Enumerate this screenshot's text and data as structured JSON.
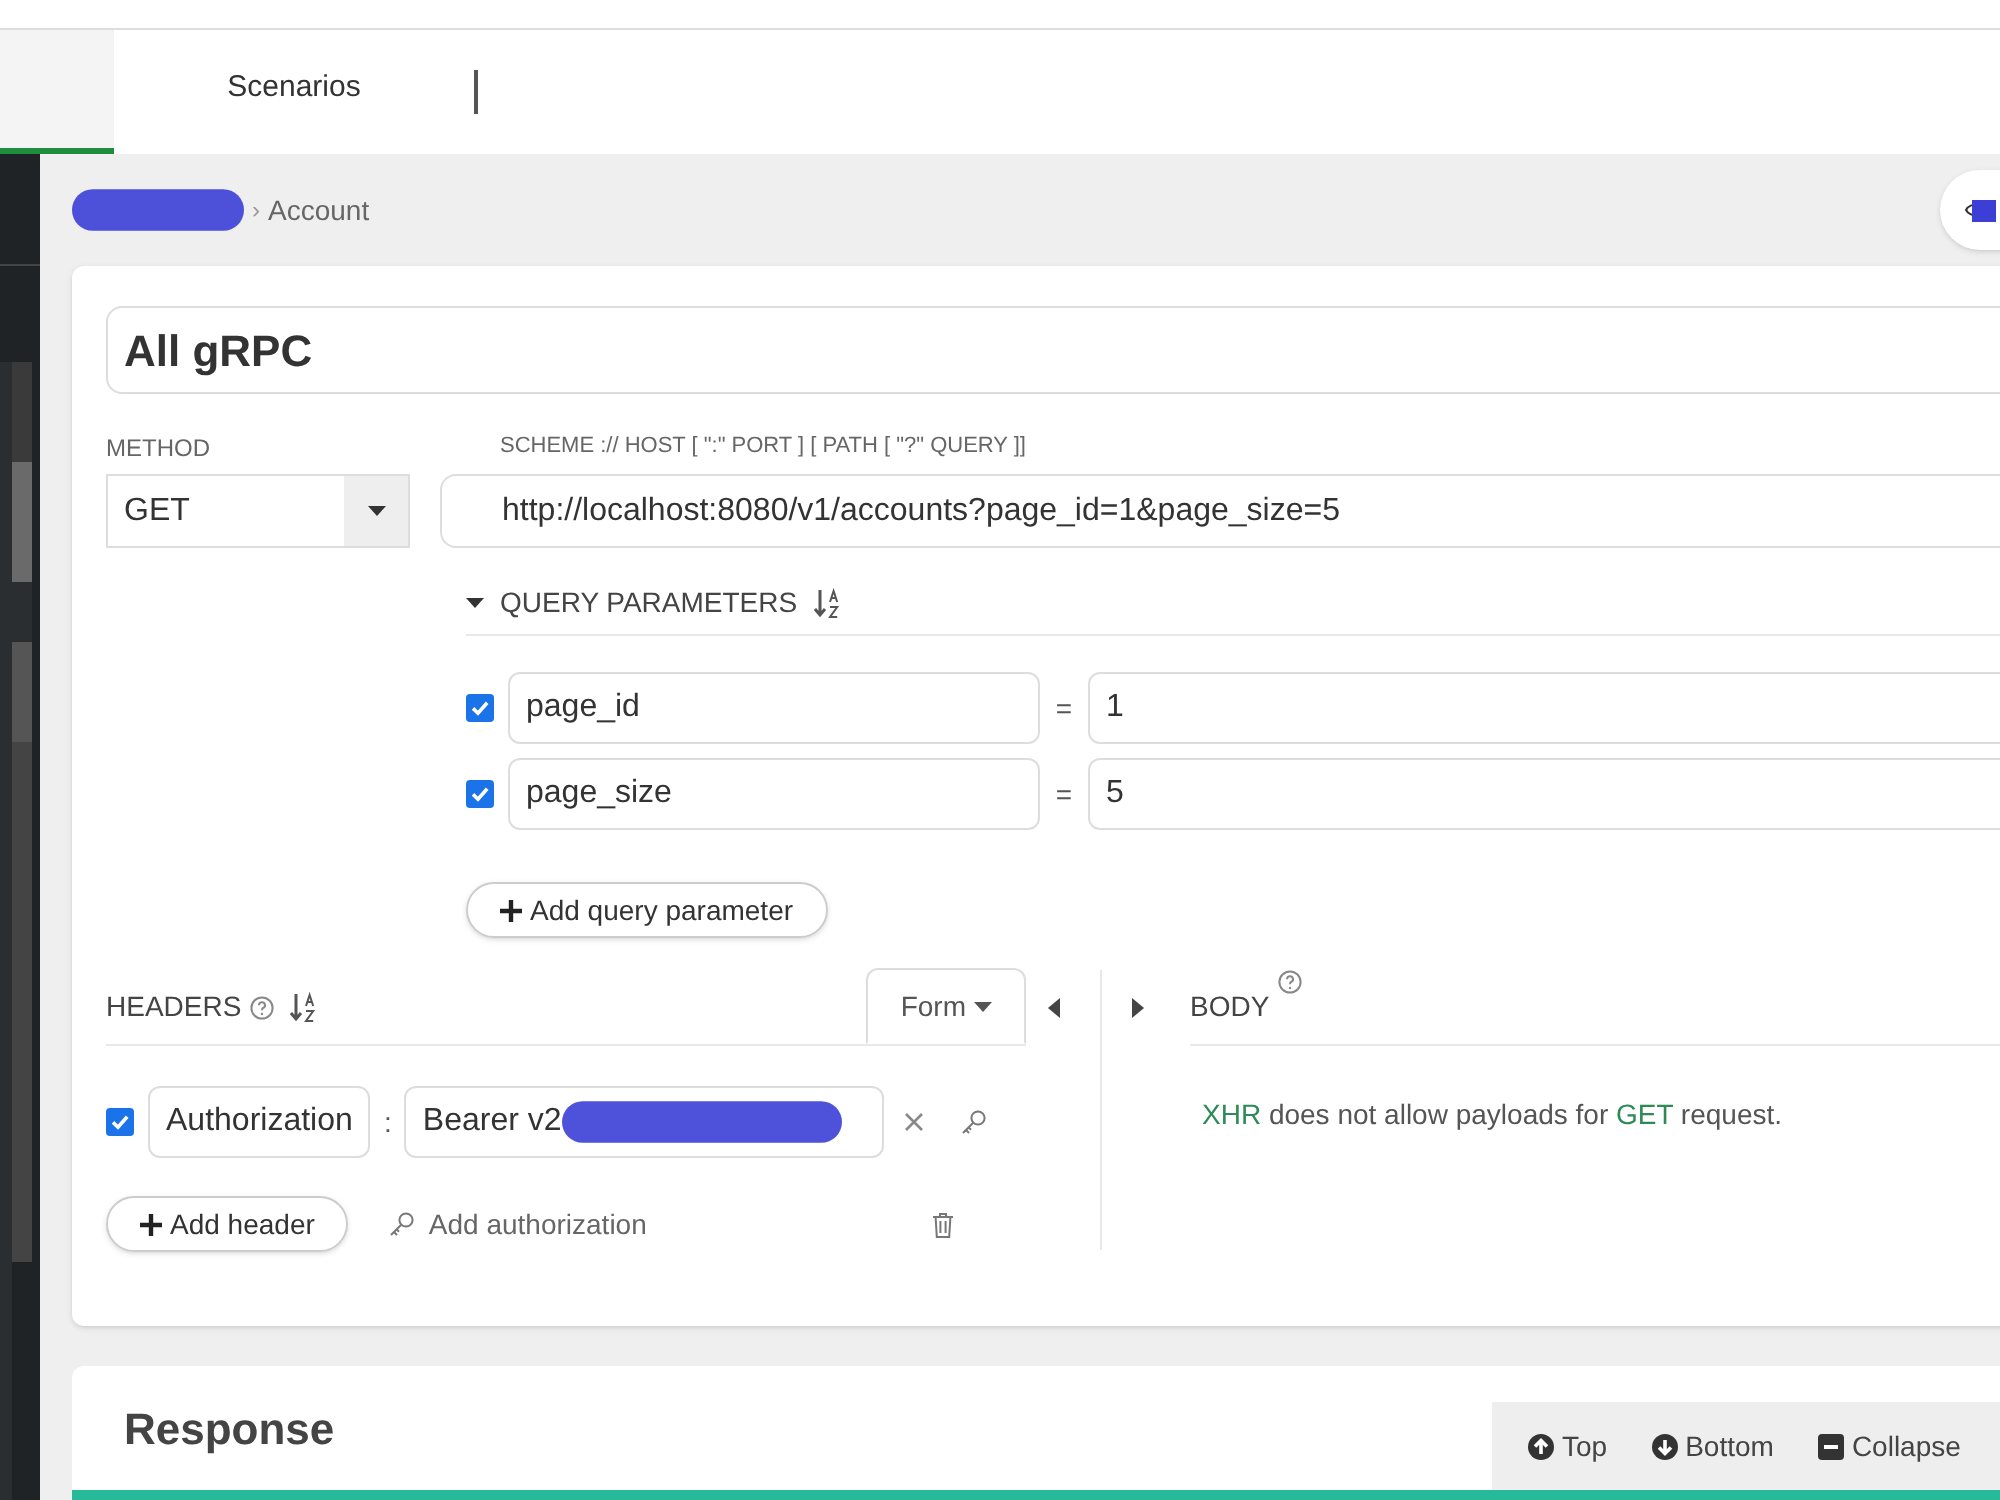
{
  "tabs": [
    {
      "selected": true
    },
    {
      "label": "Scenarios",
      "selected": false
    }
  ],
  "breadcrumb": {
    "separator": "›",
    "current": "Account"
  },
  "request": {
    "name": "All gRPC",
    "method_label": "METHOD",
    "method": "GET",
    "url_label": "SCHEME :// HOST [ \":\" PORT ] [ PATH [ \"?\" QUERY ]]",
    "url": "http://localhost:8080/v1/accounts?page_id=1&page_size=5"
  },
  "query": {
    "title": "QUERY PARAMETERS",
    "expanded": true,
    "add": "Add query parameter",
    "params": [
      {
        "name": "page_id",
        "separator": "=",
        "value": "1",
        "checked": true
      },
      {
        "name": "page_size",
        "separator": "=",
        "value": "5",
        "checked": true
      }
    ]
  },
  "headers": {
    "title": "HEADERS",
    "mode": "Form",
    "add": "Add header",
    "auth": "Add authorization",
    "items": [
      {
        "name": "Authorization",
        "separator": ":",
        "value": "Bearer v2",
        "checked": true
      }
    ]
  },
  "body": {
    "title": "BODY",
    "message": [
      {
        "text": "XHR",
        "kind": "code"
      },
      {
        "text": " does not allow payloads for ",
        "kind": "plain"
      },
      {
        "text": "GET",
        "kind": "code"
      },
      {
        "text": " request.",
        "kind": "plain"
      }
    ]
  },
  "response": {
    "title": "Response",
    "actions": [
      {
        "label": "Top",
        "kind": "up"
      },
      {
        "label": "Bottom",
        "kind": "down"
      },
      {
        "label": "Collapse",
        "kind": "collapse"
      }
    ]
  }
}
